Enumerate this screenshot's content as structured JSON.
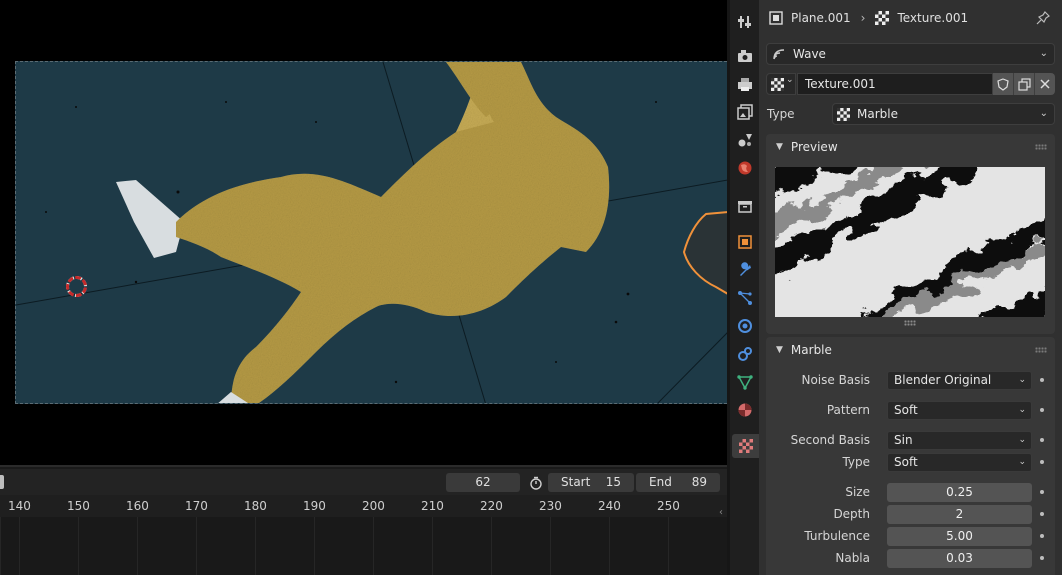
{
  "breadcrumb": {
    "object": "Plane.001",
    "texture": "Texture.001"
  },
  "modifier_select": {
    "value": "Wave"
  },
  "texture_slot": {
    "name": "Texture.001"
  },
  "type_row": {
    "label": "Type",
    "value": "Marble"
  },
  "preview_panel": {
    "title": "Preview"
  },
  "marble_panel": {
    "title": "Marble",
    "noise_basis": {
      "label": "Noise Basis",
      "value": "Blender Original"
    },
    "pattern": {
      "label": "Pattern",
      "value": "Soft"
    },
    "second_basis": {
      "label": "Second Basis",
      "value": "Sin"
    },
    "type": {
      "label": "Type",
      "value": "Soft"
    },
    "size": {
      "label": "Size",
      "value": "0.25"
    },
    "depth": {
      "label": "Depth",
      "value": "2"
    },
    "turbulence": {
      "label": "Turbulence",
      "value": "5.00"
    },
    "nabla": {
      "label": "Nabla",
      "value": "0.03"
    }
  },
  "timeline": {
    "current_frame": "62",
    "start_label": "Start",
    "start_value": "15",
    "end_label": "End",
    "end_value": "89",
    "ticks": [
      "140",
      "150",
      "160",
      "170",
      "180",
      "190",
      "200",
      "210",
      "220",
      "230",
      "240",
      "250"
    ]
  },
  "tabs": [
    "tool-icon",
    "render-icon",
    "output-icon",
    "view-layer-icon",
    "scene-icon",
    "world-icon",
    "collection-icon",
    "object-icon",
    "modifier-icon",
    "particles-icon",
    "physics-icon",
    "constraints-icon",
    "data-icon",
    "material-icon",
    "texture-icon"
  ],
  "colors": {
    "selection_outline": "#f0913a",
    "camera_bg": "#1e3a47",
    "figure": "#b59a45",
    "panel": "#303030"
  }
}
